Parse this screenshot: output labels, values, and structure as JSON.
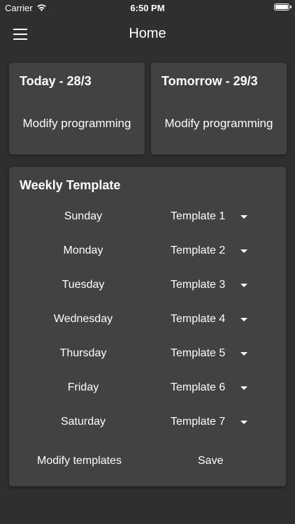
{
  "status_bar": {
    "carrier": "Carrier",
    "time": "6:50 PM"
  },
  "app_bar": {
    "title": "Home"
  },
  "today_card": {
    "title": "Today - 28/3",
    "action": "Modify programming"
  },
  "tomorrow_card": {
    "title": "Tomorrow - 29/3",
    "action": "Modify programming"
  },
  "weekly_template": {
    "title": "Weekly Template",
    "rows": [
      {
        "day": "Sunday",
        "template": "Template 1"
      },
      {
        "day": "Monday",
        "template": "Template 2"
      },
      {
        "day": "Tuesday",
        "template": "Template 3"
      },
      {
        "day": "Wednesday",
        "template": "Template 4"
      },
      {
        "day": "Thursday",
        "template": "Template 5"
      },
      {
        "day": "Friday",
        "template": "Template 6"
      },
      {
        "day": "Saturday",
        "template": "Template 7"
      }
    ],
    "modify_label": "Modify templates",
    "save_label": "Save"
  },
  "colors": {
    "background": "#2f2f2f",
    "card": "#424242",
    "text": "#ffffff"
  }
}
